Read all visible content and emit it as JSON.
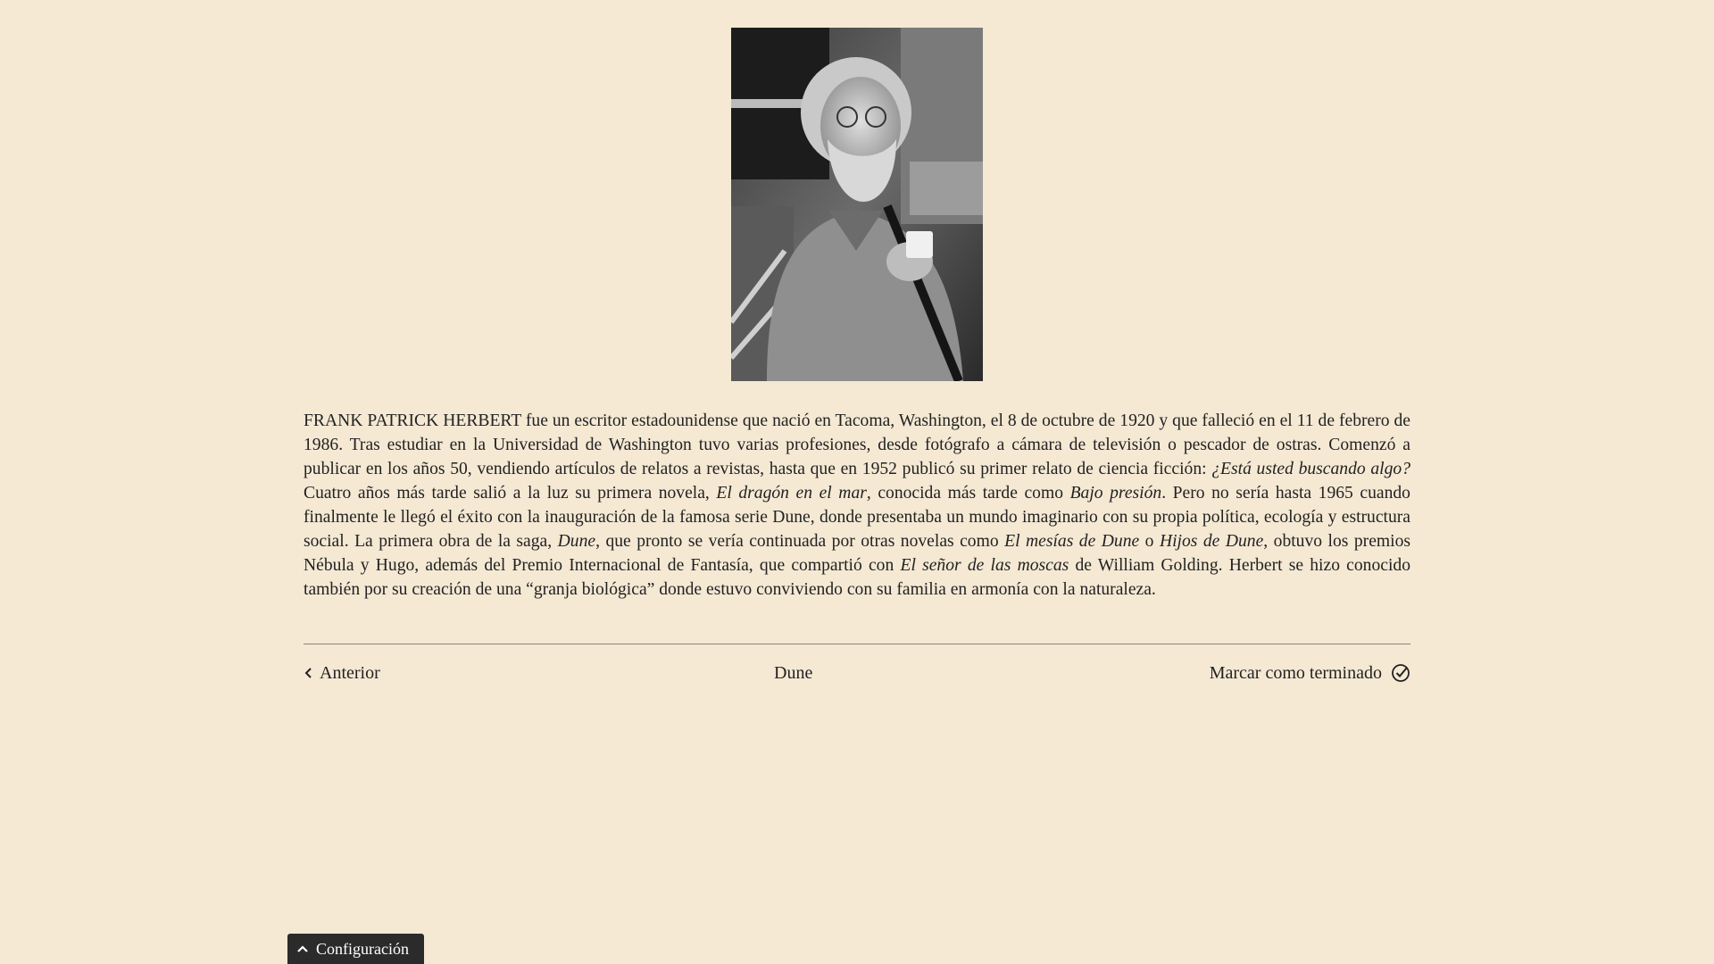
{
  "photo": {
    "alt": "Frank Herbert"
  },
  "bio": {
    "p1": "FRANK PATRICK HERBERT fue un escritor estadounidense que nació en Tacoma, Washington, el 8 de octubre de 1920 y que falleció en el 11 de febrero de 1986. Tras estudiar en la Universidad de Washington tuvo varias profesiones, desde fotógrafo a cámara de televisión o pescador de ostras. Comenzó a publicar en los años 50, vendiendo artículos de relatos a revistas, hasta que en 1952 publicó su primer relato de ciencia ficción: ",
    "t1": "¿Está usted buscando algo?",
    "p2": " Cuatro años más tarde salió a la luz su primera novela, ",
    "t2": "El dragón en el mar",
    "p3": ", conocida más tarde como ",
    "t3": "Bajo presión",
    "p4": ". Pero no sería hasta 1965 cuando finalmente le llegó el éxito con la inauguración de la famosa serie Dune, donde presentaba un mundo imaginario con su propia política, ecología y estructura social. La primera obra de la saga, ",
    "t4": "Dune",
    "p5": ", que pronto se vería continuada por otras novelas como ",
    "t5": "El mesías de Dune",
    "p6": " o ",
    "t6": "Hijos de Dune",
    "p7": ", obtuvo los premios Nébula y Hugo, además del Premio Internacional de Fantasía, que compartió con ",
    "t7": "El señor de las moscas",
    "p8": " de William Golding. Herbert se hizo conocido también por su creación de una “granja biológica” donde estuvo conviviendo con su familia en armonía con la naturaleza."
  },
  "nav": {
    "prev_label": "Anterior",
    "prev_icon": "chevron-left-icon",
    "title": "Dune",
    "done_label": "Marcar como terminado",
    "done_icon": "check-circle-icon"
  },
  "config": {
    "label": "Configuración",
    "icon": "chevron-up-icon"
  },
  "colors": {
    "background": "#f5e9d4",
    "text": "#222222",
    "config_bar": "#2b2b2b"
  }
}
